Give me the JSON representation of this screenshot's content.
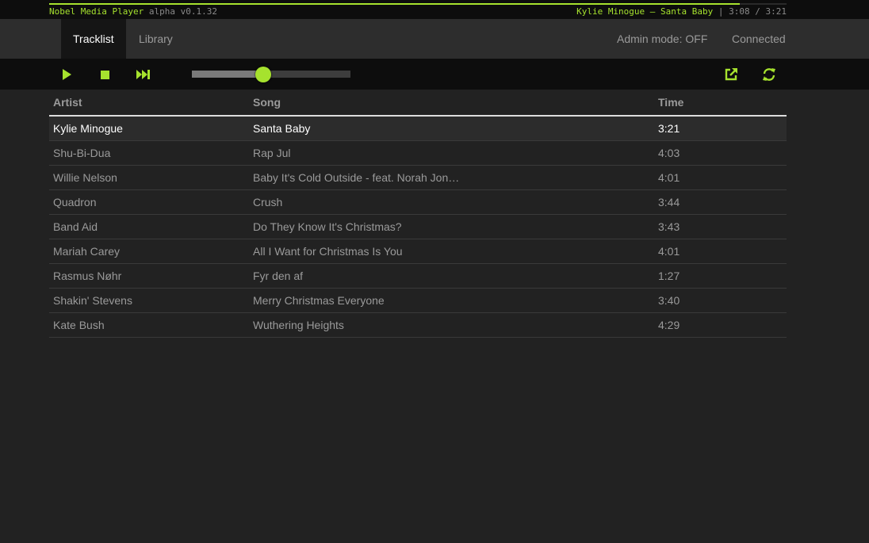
{
  "topbar": {
    "app_name": "Nobel Media Player",
    "version": "alpha v0.1.32",
    "now_playing": "Kylie Minogue – Santa Baby",
    "separator": "|",
    "time": "3:08 / 3:21",
    "progress_fraction": 0.937
  },
  "nav": {
    "tabs": [
      {
        "label": "Tracklist",
        "active": true
      },
      {
        "label": "Library",
        "active": false
      }
    ],
    "admin_mode": "Admin mode: OFF",
    "connection": "Connected"
  },
  "controls": {
    "play_icon": "play-icon",
    "stop_icon": "stop-icon",
    "next_icon": "skip-forward-icon",
    "volume_fraction": 0.45,
    "share_icon": "external-link-icon",
    "refresh_icon": "refresh-icon",
    "accent_color": "#a6e22e"
  },
  "tracklist": {
    "headers": {
      "artist": "Artist",
      "song": "Song",
      "time": "Time"
    },
    "rows": [
      {
        "artist": "Kylie Minogue",
        "song": "Santa Baby",
        "time": "3:21",
        "current": true
      },
      {
        "artist": "Shu-Bi-Dua",
        "song": "Rap Jul",
        "time": "4:03"
      },
      {
        "artist": "Willie Nelson",
        "song": "Baby It's Cold Outside - feat. Norah Jon…",
        "time": "4:01"
      },
      {
        "artist": "Quadron",
        "song": "Crush",
        "time": "3:44"
      },
      {
        "artist": "Band Aid",
        "song": "Do They Know It's Christmas?",
        "time": "3:43"
      },
      {
        "artist": "Mariah Carey",
        "song": "All I Want for Christmas Is You",
        "time": "4:01"
      },
      {
        "artist": "Rasmus Nøhr",
        "song": "Fyr den af",
        "time": "1:27"
      },
      {
        "artist": "Shakin' Stevens",
        "song": "Merry Christmas Everyone",
        "time": "3:40"
      },
      {
        "artist": "Kate Bush",
        "song": "Wuthering Heights",
        "time": "4:29"
      }
    ]
  }
}
